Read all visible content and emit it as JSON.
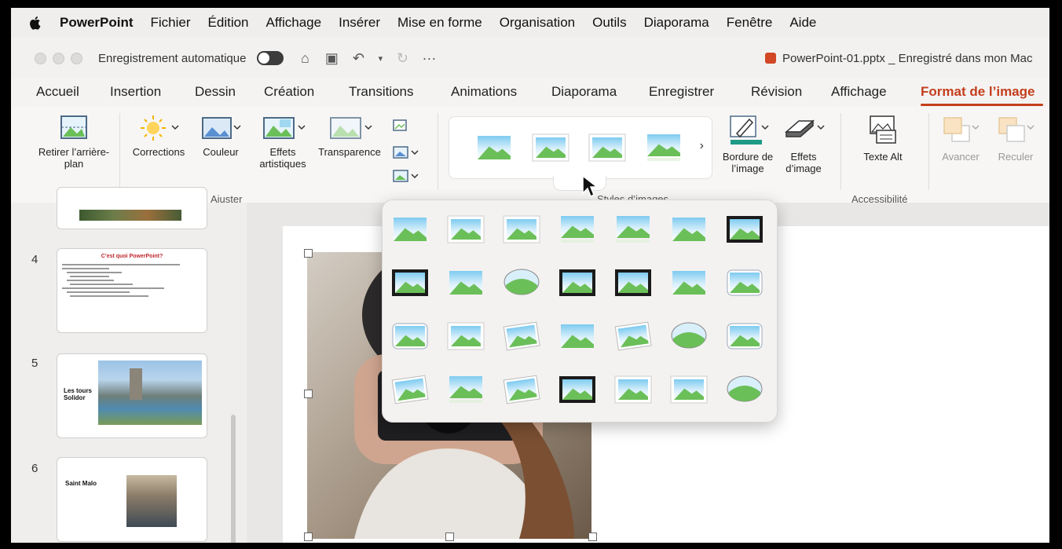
{
  "menubar": {
    "app": "PowerPoint",
    "items": [
      "Fichier",
      "Édition",
      "Affichage",
      "Insérer",
      "Mise en forme",
      "Organisation",
      "Outils",
      "Diaporama",
      "Fenêtre",
      "Aide"
    ]
  },
  "titlebar": {
    "autosave_label": "Enregistrement automatique",
    "more": "···",
    "doc_title": "PowerPoint-01.pptx _ Enregistré dans mon Mac"
  },
  "tabs": [
    "Accueil",
    "Insertion",
    "Dessin",
    "Création",
    "Transitions",
    "Animations",
    "Diaporama",
    "Enregistrer",
    "Révision",
    "Affichage",
    "Format de l’image"
  ],
  "ribbon": {
    "remove_bg": "Retirer l’arrière-plan",
    "corrections": "Corrections",
    "couleur": "Couleur",
    "effets_artistiques": "Effets artistiques",
    "transparence": "Transparence",
    "group_ajuster": "Ajuster",
    "group_styles": "Styles d’images",
    "bordure": "Bordure de l’image",
    "effets_image": "Effets d’image",
    "texte_alt": "Texte Alt",
    "group_accessibilite": "Accessibilité",
    "avancer": "Avancer",
    "reculer": "Reculer"
  },
  "slides": [
    {
      "num": "4",
      "title": "C’est quoi PowerPoint?"
    },
    {
      "num": "5",
      "title": "Les tours Solidor"
    },
    {
      "num": "6",
      "title": "Saint Malo"
    }
  ],
  "colors": {
    "accent": "#c43e1c",
    "green": "#6bbf59",
    "sky": "#8fd0ef"
  }
}
